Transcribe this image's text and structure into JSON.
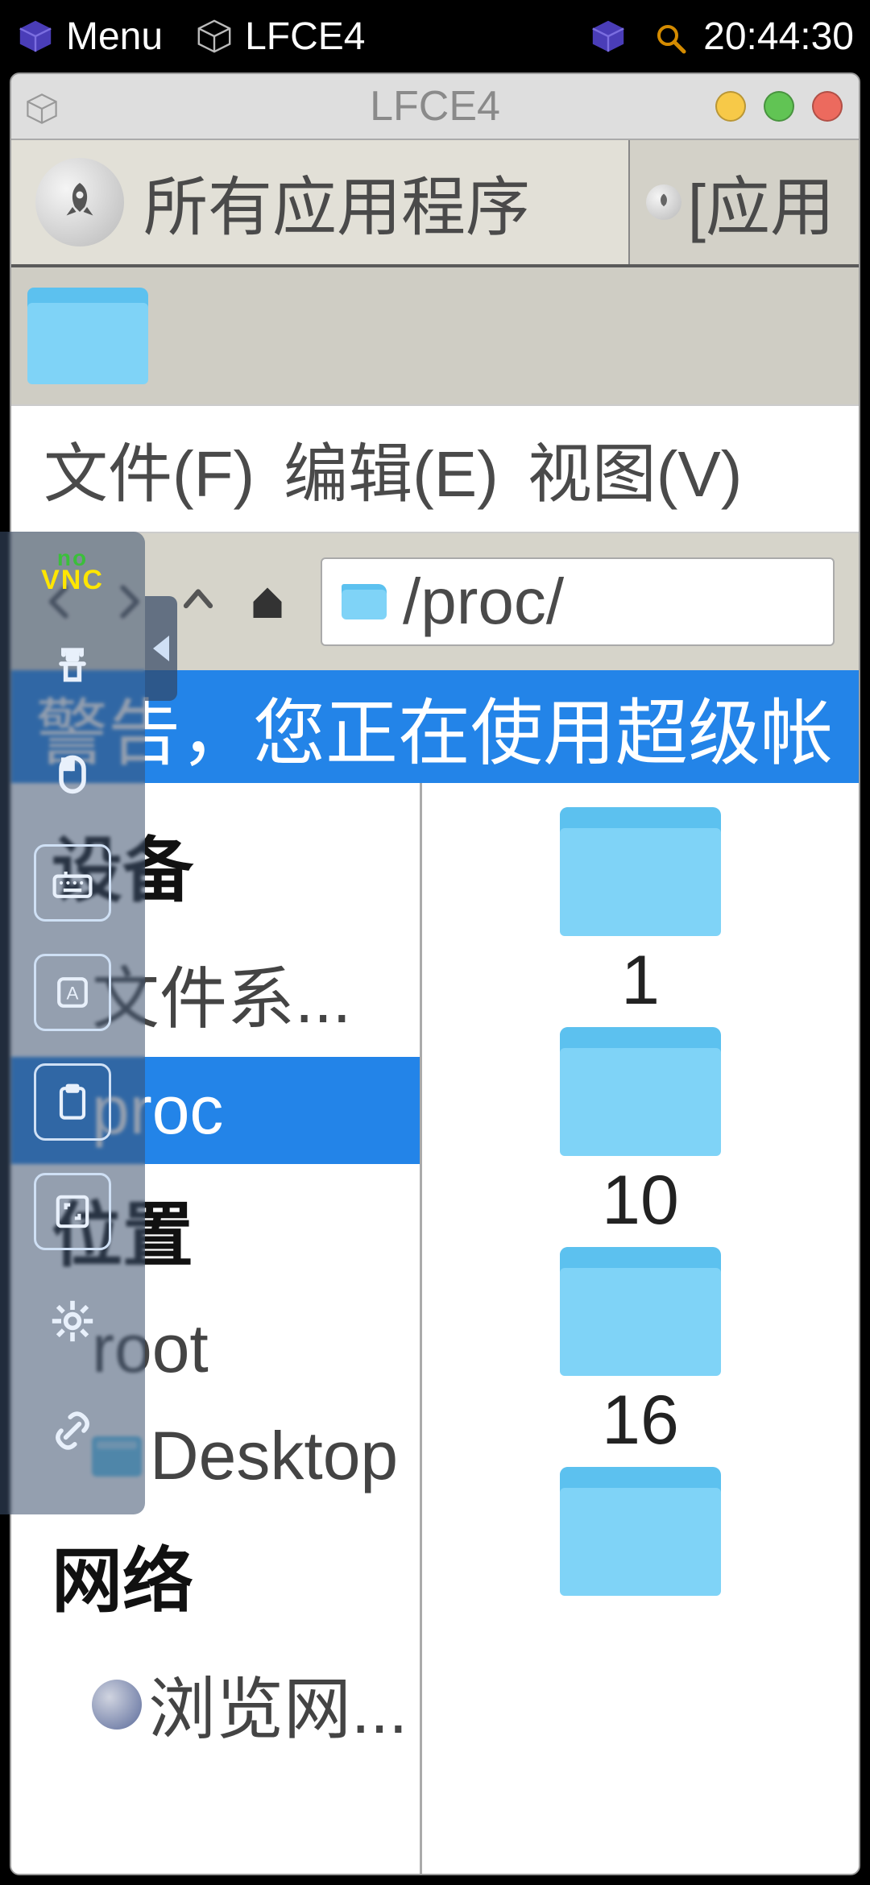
{
  "phone_bar": {
    "menu_label": "Menu",
    "task_title": "LFCE4",
    "time": "20:44:30"
  },
  "window": {
    "title": "LFCE4",
    "tabs": {
      "all_apps": "所有应用程序",
      "active_prefix": "[应用"
    }
  },
  "file_manager": {
    "menus": {
      "file": "文件(F)",
      "edit": "编辑(E)",
      "view": "视图(V)"
    },
    "path": "/proc/",
    "warning": "警告，您正在使用超级帐",
    "sidebar": {
      "devices_header": "设备",
      "filesystem": "文件系...",
      "proc": "proc",
      "places_header": "位置",
      "root": "root",
      "desktop": "Desktop",
      "network_header": "网络",
      "browse_network": "浏览网..."
    },
    "folders": [
      {
        "name": "1"
      },
      {
        "name": "10"
      },
      {
        "name": "16"
      }
    ]
  },
  "novnc": {
    "logo_top": "no",
    "logo_bottom": "VNC"
  }
}
